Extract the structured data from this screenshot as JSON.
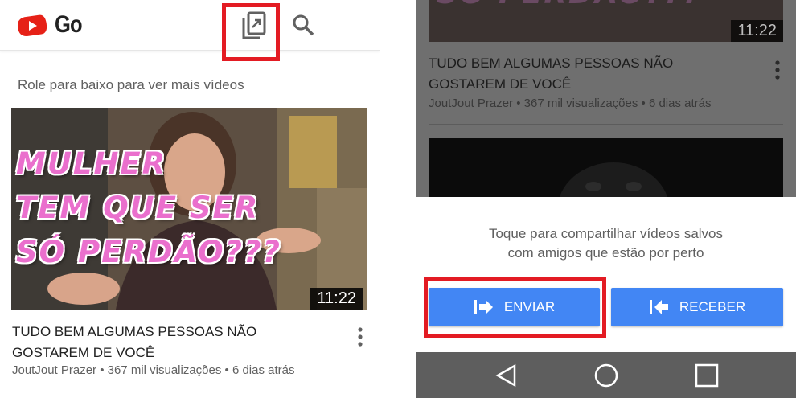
{
  "left_screen": {
    "app_name": "Go",
    "hint": "Role para baixo para ver mais vídeos",
    "video": {
      "thumbnail_text": [
        "MULHER",
        "TEM QUE SER",
        "SÓ PERDÃO???"
      ],
      "duration": "11:22",
      "title": "TUDO BEM ALGUMAS PESSOAS NÃO GOSTAREM DE VOCÊ",
      "meta": "JoutJout Prazer • 367 mil visualizações • 6 dias atrás"
    },
    "icons": {
      "share": "share-saved-videos-icon",
      "search": "search-icon",
      "more": "more-vert-icon",
      "logo": "youtube-play-logo-icon"
    },
    "highlight_color": "#e31b23"
  },
  "right_screen": {
    "background_video": {
      "thumbnail_text": "SÓ PERDÃO???",
      "duration": "11:22",
      "title": "TUDO BEM ALGUMAS PESSOAS NÃO GOSTAREM DE VOCÊ",
      "meta": "JoutJout Prazer • 367 mil visualizações • 6 dias atrás"
    },
    "sheet": {
      "message_line1": "Toque para compartilhar vídeos salvos",
      "message_line2": "com amigos que estão por perto",
      "send_label": "ENVIAR",
      "receive_label": "RECEBER"
    },
    "button_color": "#4286f4",
    "icons": {
      "send": "send-arrow-icon",
      "receive": "receive-arrow-icon",
      "back": "nav-back-icon",
      "home": "nav-home-icon",
      "recent": "nav-recent-apps-icon"
    }
  }
}
